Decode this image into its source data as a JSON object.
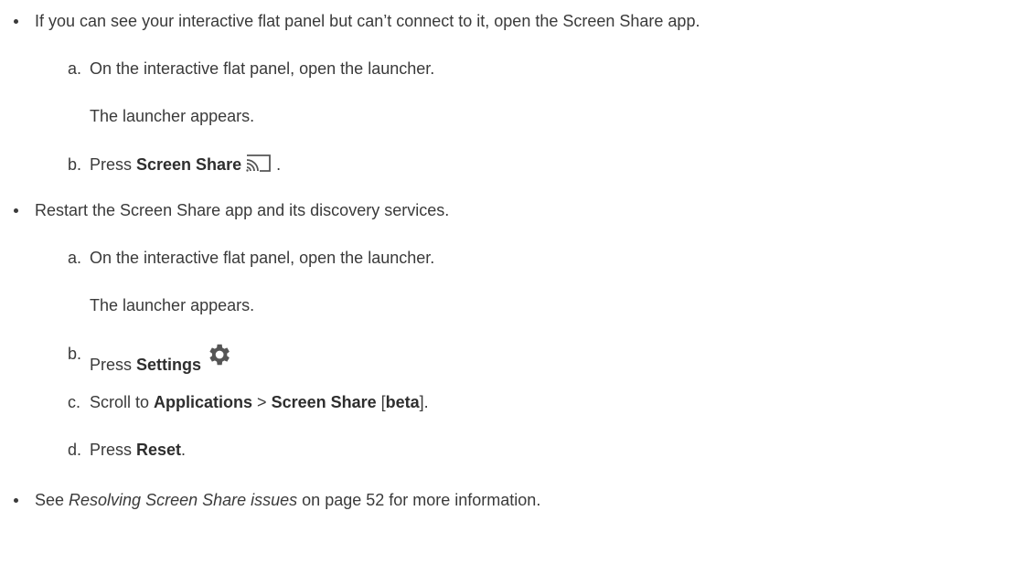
{
  "items": [
    {
      "text": "If you can see your interactive flat panel but can’t connect to it, open the Screen Share app.",
      "steps": [
        {
          "marker": "a.",
          "text": "On the interactive flat panel, open the launcher.",
          "result": "The launcher appears."
        },
        {
          "marker": "b.",
          "prefix": "Press ",
          "bold": "Screen Share",
          "suffix": ".",
          "icon": "screen-share-cast-icon"
        }
      ]
    },
    {
      "text": "Restart the Screen Share app and its discovery services.",
      "steps": [
        {
          "marker": "a.",
          "text": "On the interactive flat panel, open the launcher.",
          "result": "The launcher appears."
        },
        {
          "marker": "b.",
          "prefix": "Press ",
          "bold": "Settings",
          "icon": "gear-icon"
        },
        {
          "marker": "c.",
          "prefix": "Scroll to ",
          "bold1": "Applications",
          "sep": " > ",
          "bold2": "Screen Share",
          "mid": " [",
          "bold3": "beta",
          "suffix": "]."
        },
        {
          "marker": "d.",
          "prefix": "Press ",
          "bold": "Reset",
          "suffix": "."
        }
      ]
    },
    {
      "prefix": "See ",
      "italic": "Resolving Screen Share issues",
      "suffix": " on page 52 for more information."
    }
  ]
}
